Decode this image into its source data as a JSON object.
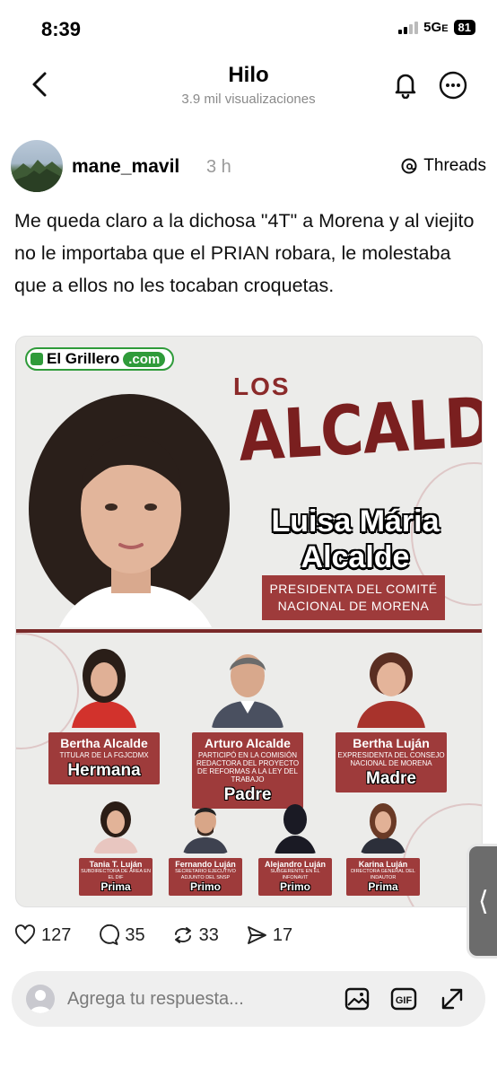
{
  "status_bar": {
    "time": "8:39",
    "network": "5G",
    "network_suffix": "E",
    "battery": "81"
  },
  "header": {
    "title": "Hilo",
    "subtitle": "3.9 mil visualizaciones"
  },
  "post": {
    "username": "mane_mavil",
    "time_ago": "3 h",
    "platform_label": "Threads",
    "text": "Me queda claro a la dichosa \"4T\" a Morena y al viejito no le importaba que el PRIAN robara, le molestaba que a ellos no les tocaban croquetas."
  },
  "image": {
    "logo_main": "El Grillero",
    "logo_suffix": ".com",
    "heading_small": "LOS",
    "heading_big": "ALCALDE",
    "main_name_line1": "Luisa Mária",
    "main_name_line2": "Alcalde",
    "main_role": "PRESIDENTA DEL COMITÉ NACIONAL DE MORENA",
    "relatives_top": [
      {
        "name": "Bertha Alcalde",
        "title": "TITULAR DE LA FGJCDMX",
        "kin": "Hermana"
      },
      {
        "name": "Arturo Alcalde",
        "title": "PARTICIPÓ EN LA COMISIÓN REDACTORA DEL PROYECTO DE REFORMAS A LA LEY DEL TRABAJO",
        "kin": "Padre"
      },
      {
        "name": "Bertha Luján",
        "title": "EXPRESIDENTA DEL CONSEJO NACIONAL DE MORENA",
        "kin": "Madre"
      }
    ],
    "relatives_bottom": [
      {
        "name": "Tania T. Luján",
        "title": "SUBDIRECTORA DE ÁREA EN EL DIF",
        "kin": "Prima"
      },
      {
        "name": "Fernando Luján",
        "title": "SECRETARIO EJECUTIVO ADJUNTO DEL SNSP",
        "kin": "Primo"
      },
      {
        "name": "Alejandro Luján",
        "title": "SUBGERENTE EN EL INFONAVIT",
        "kin": "Primo"
      },
      {
        "name": "Karina Luján",
        "title": "DIRECTORA GENERAL DEL INDAUTOR",
        "kin": "Prima"
      }
    ]
  },
  "actions": {
    "likes": "127",
    "comments": "35",
    "reposts": "33",
    "shares": "17"
  },
  "reply": {
    "placeholder": "Agrega tu respuesta..."
  },
  "colors": {
    "accent_red": "#9e3b3b",
    "dark_red": "#7a1f1f",
    "logo_green": "#2f9b3a"
  }
}
